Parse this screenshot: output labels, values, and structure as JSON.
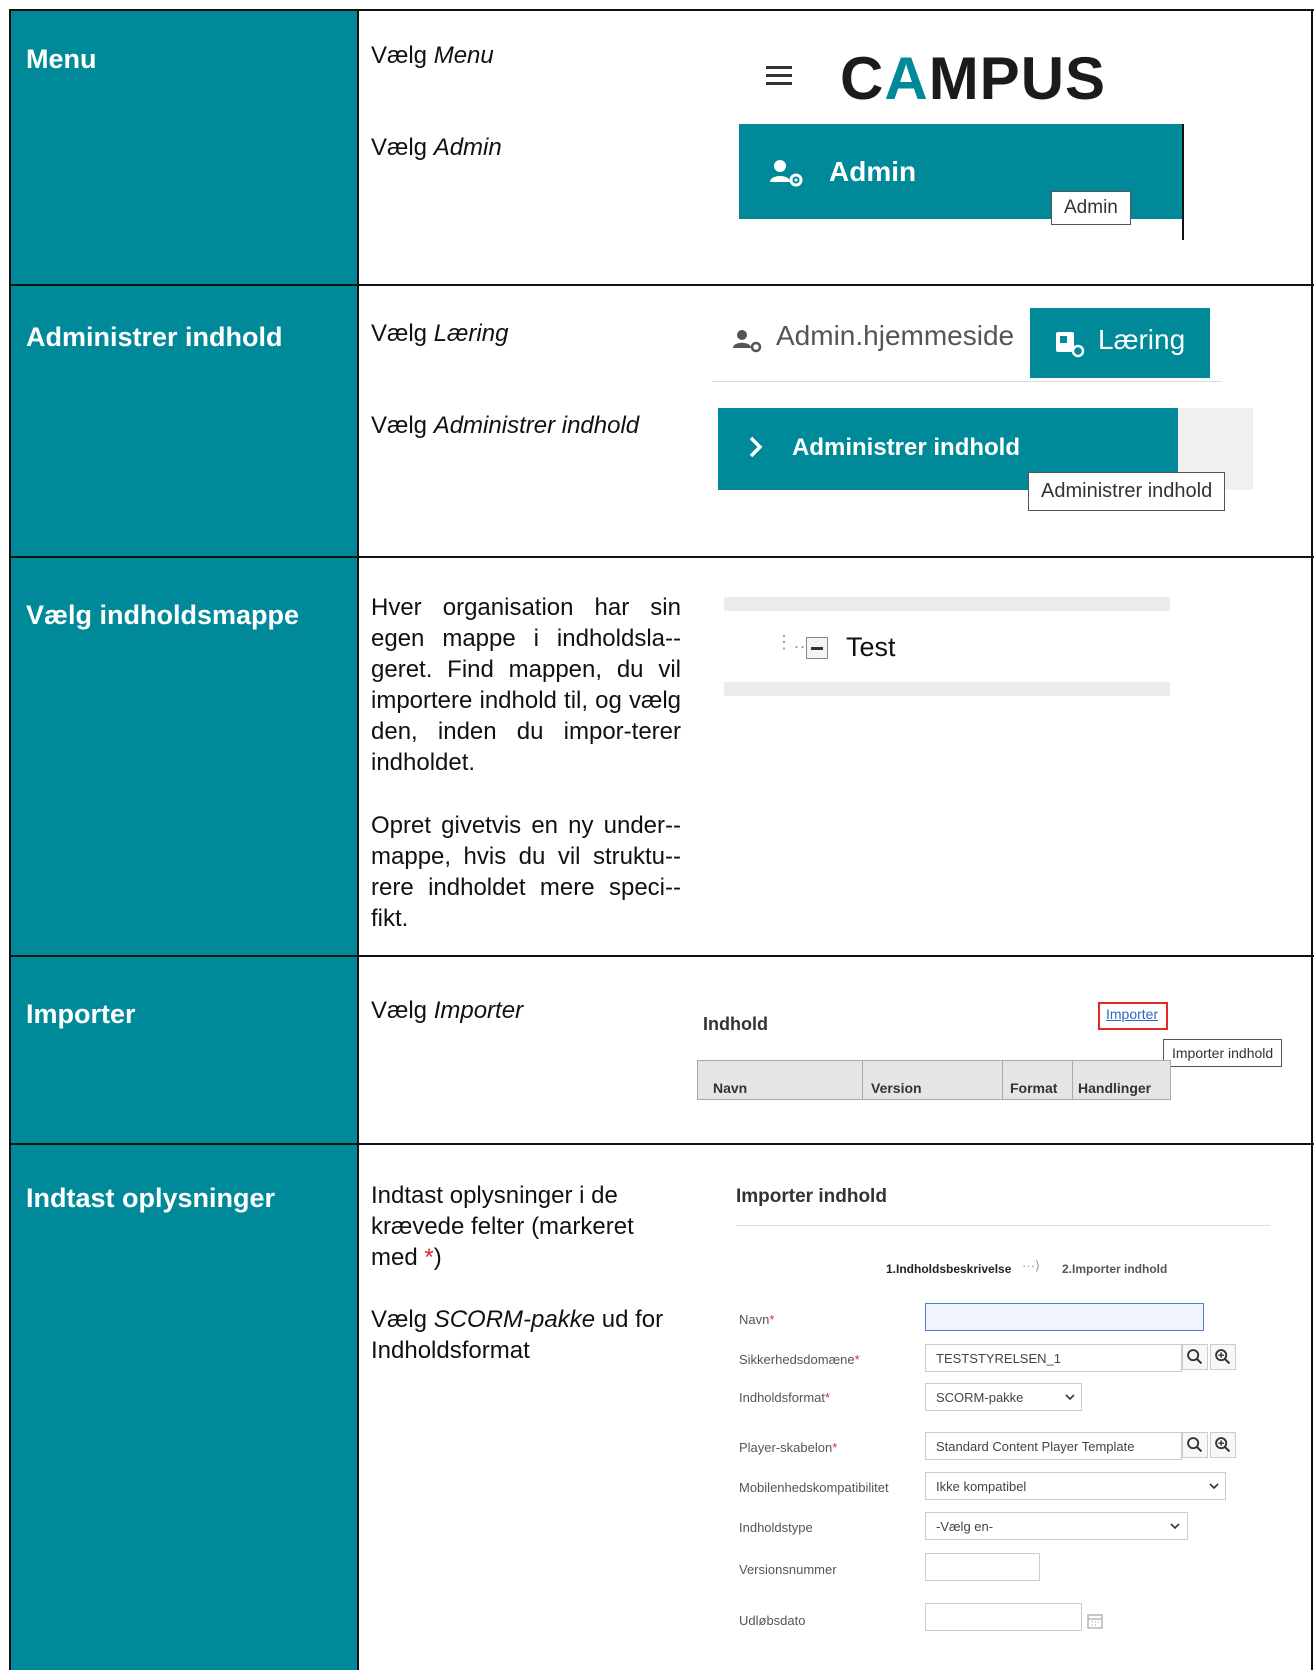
{
  "sections": [
    {
      "title": "Menu"
    },
    {
      "title": "Administrer indhold"
    },
    {
      "title": "Vælg indholdsmappe"
    },
    {
      "title": "Importer"
    },
    {
      "title": "Indtast oplysninger"
    }
  ],
  "menu": {
    "instr1_prefix": "Vælg ",
    "instr1_item": "Menu",
    "instr2_prefix": "Vælg ",
    "instr2_item": "Admin",
    "logo": {
      "c": "C",
      "a": "A",
      "rest": "MPUS"
    },
    "admin_label": "Admin",
    "admin_tooltip": "Admin",
    "icons": {
      "menu": "hamburger-icon",
      "admin": "user-gear-icon"
    }
  },
  "administrer": {
    "instr1_prefix": "Vælg ",
    "instr1_item": "Læring",
    "instr2_prefix": "Vælg ",
    "instr2_item": "Administrer indhold",
    "tab_home": "Admin.hjemmeside",
    "tab_laering": "Læring",
    "panel_label": "Administrer indhold",
    "tooltip": "Administrer indhold"
  },
  "mappe": {
    "para1": "Hver organisation har sin egen mappe i indholdsla-­geret. Find mappen, du vil importere indhold til, og vælg den, inden du impor-­terer indholdet.",
    "para2": "Opret givetvis en ny under-­mappe, hvis du vil struktu-­rere indholdet mere speci-­fikt.",
    "tree_dots": "⋮..",
    "tree_label": "Test"
  },
  "importer": {
    "instr_prefix": "Vælg ",
    "instr_item": "Importer",
    "header": "Indhold",
    "link": "Importer",
    "tooltip": "Importer indhold",
    "columns": [
      "Navn",
      "Version",
      "Format",
      "Handlinger"
    ]
  },
  "oplysninger": {
    "instr1_a": "Indtast oplysninger i de krævede felter (markeret med ",
    "instr1_star": "*",
    "instr1_b": ")",
    "instr2_prefix": "Vælg ",
    "instr2_item": "SCORM-pakke",
    "instr2_suffix": " ud for Indholdsformat",
    "form_title": "Importer indhold",
    "step1": "1.Indholdsbeskrivelse",
    "step_arrow": "···⟩",
    "step2": "2.Importer indhold",
    "fields": {
      "navn_label": "Navn",
      "navn_value": "",
      "sikkerhed_label": "Sikkerhedsdomæne",
      "sikkerhed_value": "TESTSTYRELSEN_1",
      "format_label": "Indholdsformat",
      "format_value": "SCORM-pakke",
      "player_label": "Player-skabelon",
      "player_value": "Standard Content Player Template",
      "mobil_label": "Mobilenhedskompatibilitet",
      "mobil_value": "Ikke kompatibel",
      "type_label": "Indholdstype",
      "type_value": "-Vælg en-",
      "version_label": "Versionsnummer",
      "version_value": "",
      "udlob_label": "Udløbsdato",
      "udlob_value": ""
    },
    "required_mark": "*"
  },
  "colors": {
    "teal": "#008a99",
    "required": "#e0282a",
    "link": "#2a67c9"
  }
}
